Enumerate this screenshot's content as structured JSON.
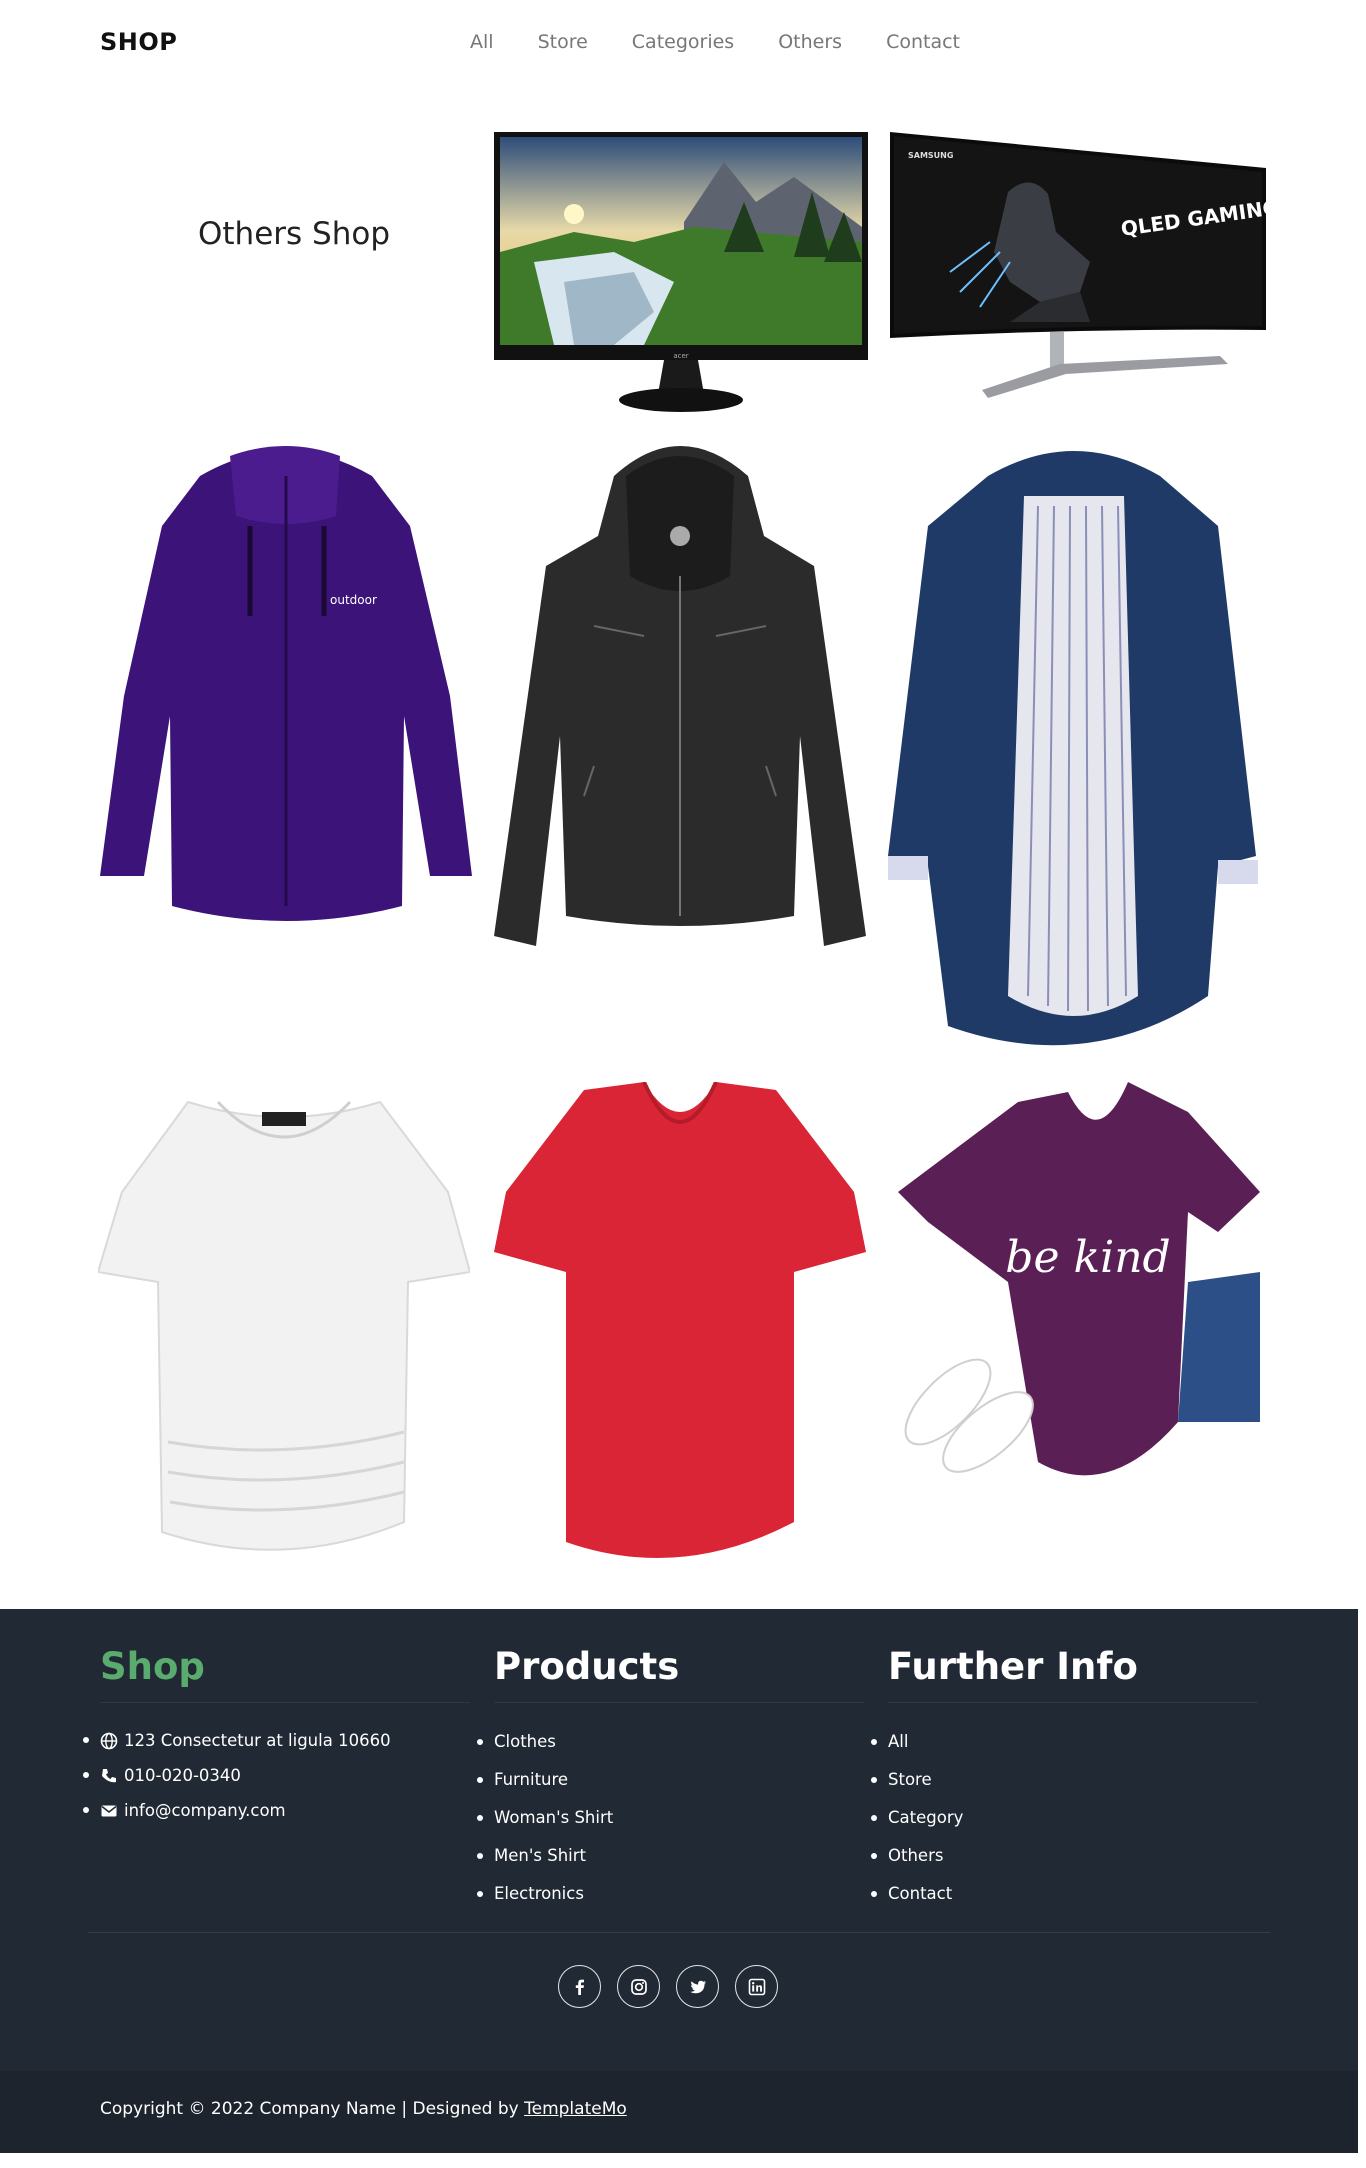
{
  "header": {
    "brand": "SHOP",
    "nav": [
      "All",
      "Store",
      "Categories",
      "Others",
      "Contact"
    ]
  },
  "hero": {
    "title": "Others Shop",
    "monitor_2_text": "QLED GAMING MONITOR",
    "monitor_2_brand": "SAMSUNG",
    "monitor_1_brand": "acer"
  },
  "products": [
    {
      "name": "purple-outdoor-jacket",
      "color": "#3c1378",
      "logo": "outdoor"
    },
    {
      "name": "black-leather-jacket",
      "color": "#2b2b2b"
    },
    {
      "name": "navy-trench-coat",
      "color": "#1f3a66"
    },
    {
      "name": "white-dolman-top",
      "color": "#f2f2f2"
    },
    {
      "name": "red-vneck-tshirt",
      "color": "#d92535"
    },
    {
      "name": "purple-be-kind-tshirt",
      "color": "#5a1f55",
      "print": "be kind"
    }
  ],
  "footer": {
    "shop": {
      "title": "Shop",
      "address": "123 Consectetur at ligula 10660",
      "phone": "010-020-0340",
      "email": "info@company.com"
    },
    "products": {
      "title": "Products",
      "items": [
        "Clothes",
        "Furniture",
        "Woman's Shirt",
        "Men's Shirt",
        "Electronics"
      ]
    },
    "further": {
      "title": "Further Info",
      "items": [
        "All",
        "Store",
        "Category",
        "Others",
        "Contact"
      ]
    },
    "socials": [
      "facebook-icon",
      "instagram-icon",
      "twitter-icon",
      "linkedin-icon"
    ],
    "copyright_prefix": "Copyright © 2022 Company Name | Designed by",
    "copyright_link": "TemplateMo"
  },
  "colors": {
    "accent": "#59ab6e",
    "footer_bg": "#212934",
    "footer_bottom_bg": "#1d242d"
  }
}
